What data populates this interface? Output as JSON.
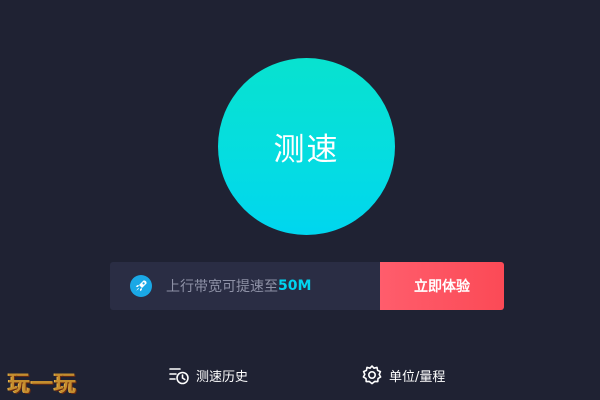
{
  "speed_test": {
    "button_label": "测速"
  },
  "promo": {
    "text": "上行带宽可提速至",
    "highlight": "50M",
    "button_label": "立即体验"
  },
  "bottom_links": {
    "history_label": "测速历史",
    "unit_label": "单位/量程"
  },
  "watermark": {
    "text": "玩一玩"
  },
  "colors": {
    "background": "#1f2233",
    "accent_cyan": "#00d6ef",
    "cta_red": "#fb4a56",
    "muted_text": "#8e91a6"
  },
  "icons": {
    "promo": "rocket-icon",
    "history": "history-clock-icon",
    "unit": "gear-icon"
  }
}
